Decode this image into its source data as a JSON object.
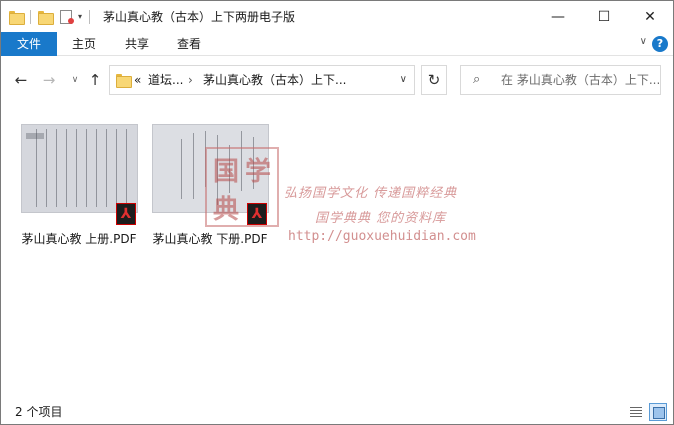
{
  "window": {
    "title": "茅山真心教（古本）上下两册电子版",
    "buttons": {
      "minimize": "—",
      "maximize": "☐",
      "close": "✕"
    }
  },
  "quick_access": {
    "icons": [
      "folder-icon",
      "new-folder-icon",
      "properties-icon",
      "customize-dropdown-icon"
    ]
  },
  "ribbon": {
    "tabs": [
      {
        "label": "文件",
        "active": true
      },
      {
        "label": "主页"
      },
      {
        "label": "共享"
      },
      {
        "label": "查看"
      }
    ],
    "help": "?",
    "collapse": "∨"
  },
  "nav": {
    "back": "←",
    "forward": "→",
    "recent": "∨",
    "up": "↑",
    "address": {
      "overflow": "«",
      "crumbs": [
        "道坛...",
        "茅山真心教（古本）上下..."
      ],
      "separator": "›",
      "dropdown": "∨"
    },
    "refresh": "↻",
    "search": {
      "icon": "⌕",
      "placeholder": "在 茅山真心教（古本）上下..."
    }
  },
  "files": [
    {
      "name": "茅山真心教 上册.PDF",
      "type": "pdf"
    },
    {
      "name": "茅山真心教 下册.PDF",
      "type": "pdf"
    }
  ],
  "watermark": {
    "stamp_chars": [
      "国",
      "学",
      "典"
    ],
    "line1": "弘扬国学文化  传递国粹经典",
    "line2": "国学典典  您的资料库",
    "url": "http://guoxuehuidian.com"
  },
  "status": {
    "item_count": "2 个项目"
  },
  "colors": {
    "accent": "#1979ca",
    "pdf_red": "#e23030",
    "watermark": "#d89a9a"
  }
}
